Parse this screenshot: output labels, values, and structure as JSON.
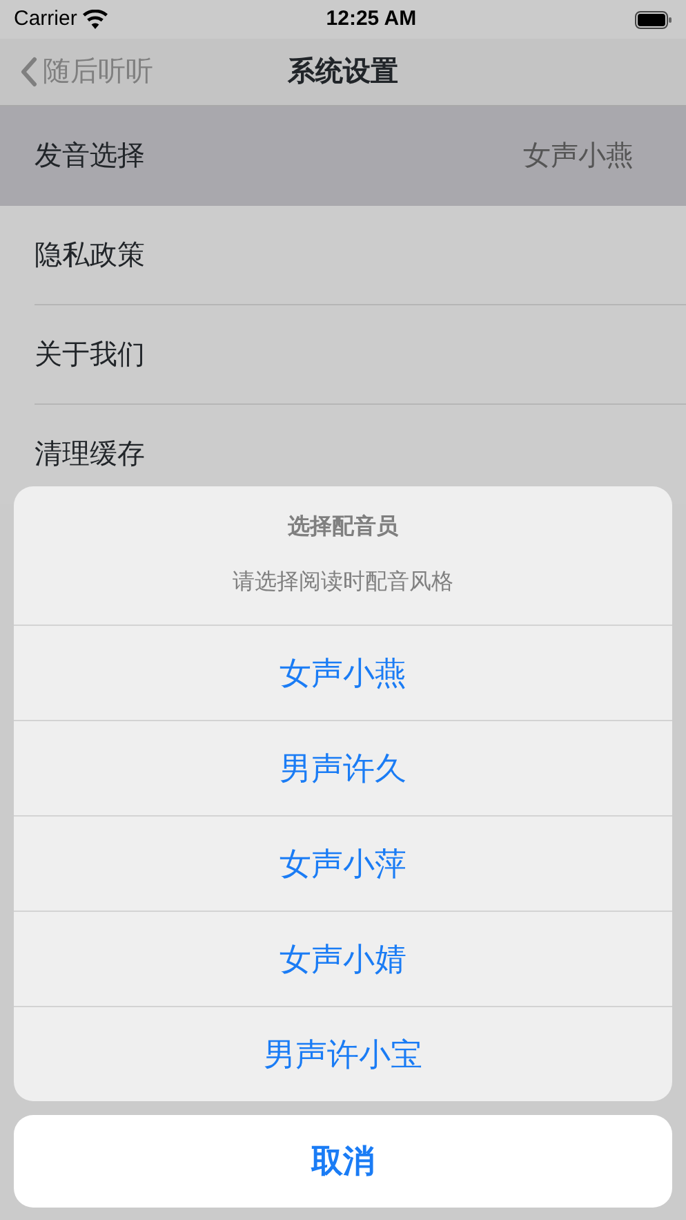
{
  "status_bar": {
    "carrier": "Carrier",
    "time": "12:25 AM"
  },
  "nav_bar": {
    "back_label": "随后听听",
    "title": "系统设置"
  },
  "settings": [
    {
      "label": "发音选择",
      "value": "女声小燕",
      "selected": true
    },
    {
      "label": "隐私政策",
      "selected": false
    },
    {
      "label": "关于我们",
      "selected": false
    },
    {
      "label": "清理缓存",
      "selected": false
    }
  ],
  "action_sheet": {
    "title": "选择配音员",
    "message": "请选择阅读时配音风格",
    "options": [
      "女声小燕",
      "男声许久",
      "女声小萍",
      "女声小婧",
      "男声许小宝"
    ],
    "cancel": "取消"
  }
}
